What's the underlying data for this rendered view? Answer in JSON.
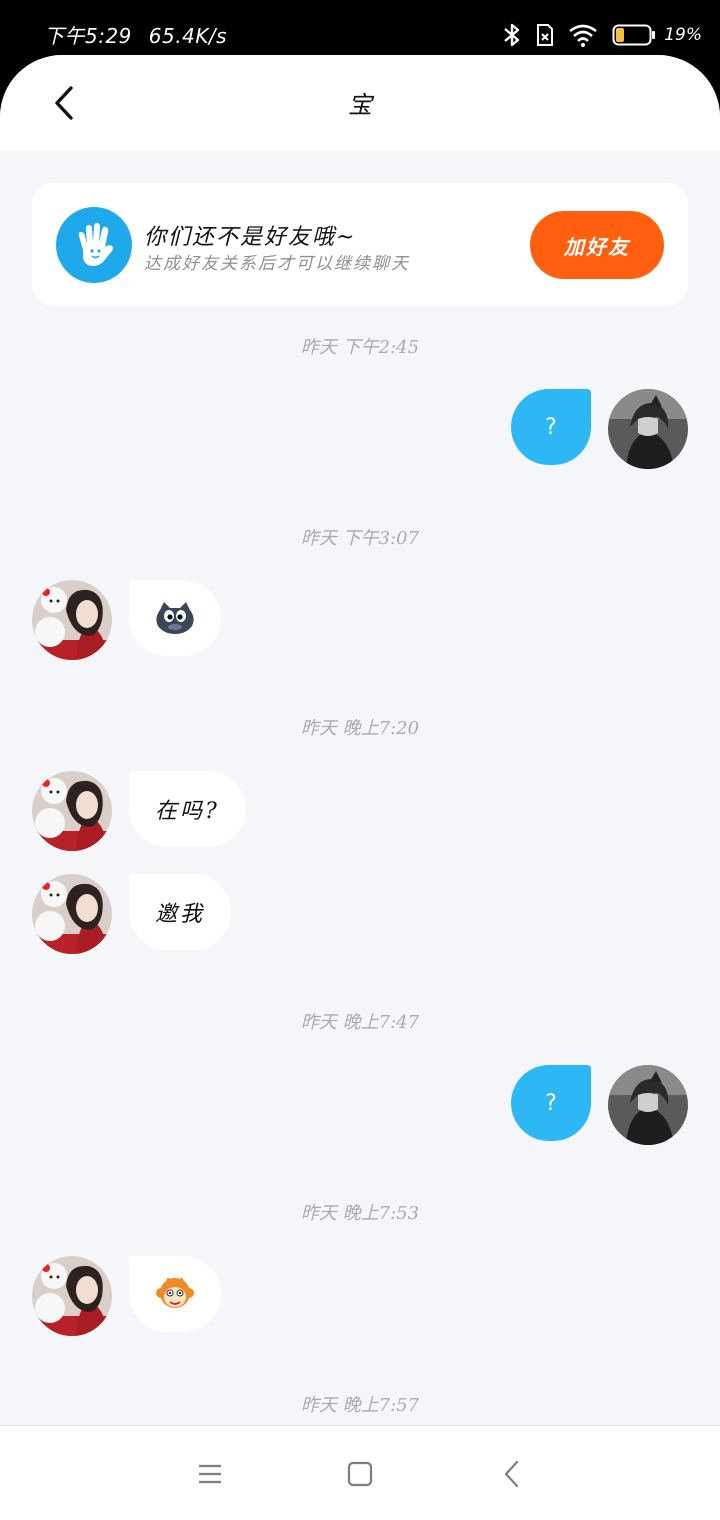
{
  "status_bar": {
    "time": "下午5:29",
    "net_speed": "65.4K/s",
    "battery": "19%"
  },
  "header": {
    "title": "宝",
    "back_icon": "chevron-left-icon"
  },
  "friend_card": {
    "title": "你们还不是好友哦~",
    "subtitle": "达成好友关系后才可以继续聊天",
    "button_label": "加好友"
  },
  "messages": {
    "ts1": "昨天 下午2:45",
    "m1": "?",
    "ts2": "昨天 下午3:07",
    "m2_emoji": "sticker-emoji",
    "ts3": "昨天 晚上7:20",
    "m3": "在吗?",
    "m4": "邀我",
    "ts4": "昨天 晚上7:47",
    "m5": "?",
    "ts5": "昨天 晚上7:53",
    "m6_emoji": "monkey-emoji",
    "ts6": "昨天 晚上7:57"
  },
  "colors": {
    "accent_orange": "#ff5f0e",
    "bubble_blue": "#2db7f5",
    "background": "#f4f6f9"
  }
}
